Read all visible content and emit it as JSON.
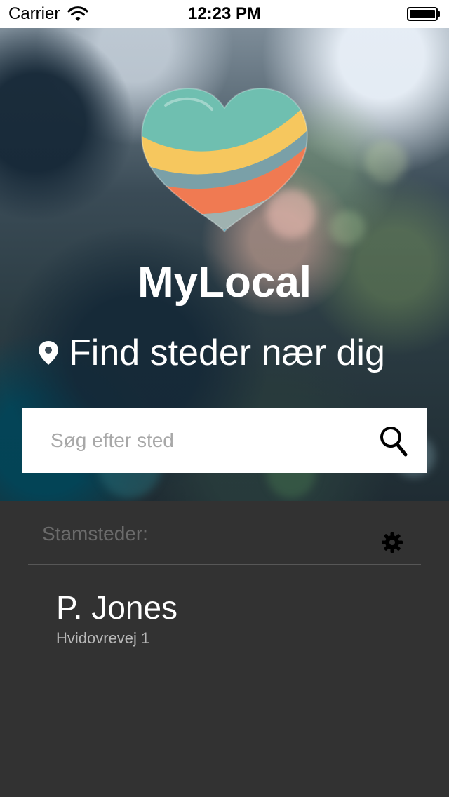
{
  "status_bar": {
    "carrier": "Carrier",
    "time": "12:23 PM",
    "wifi_icon": "wifi-icon",
    "battery_icon": "battery-icon"
  },
  "hero": {
    "logo_icon": "heart-logo",
    "app_title": "MyLocal",
    "location_icon": "map-pin-icon",
    "find_text": "Find steder nær dig",
    "search": {
      "placeholder": "Søg efter sted",
      "value": "",
      "icon": "search-icon"
    }
  },
  "favorites": {
    "label": "Stamsteder:",
    "settings_icon": "gear-icon",
    "items": [
      {
        "name": "P. Jones",
        "address": "Hvidovrevej 1"
      }
    ]
  },
  "colors": {
    "status_bar_bg": "#ffffff",
    "panel_bg": "#323232",
    "divider": "#575757",
    "search_bg": "#ffffff",
    "heart_teal": "#6fbfb0",
    "heart_yellow": "#f6c75e",
    "heart_orange": "#f07a52",
    "heart_blue": "#4b9bb5"
  }
}
